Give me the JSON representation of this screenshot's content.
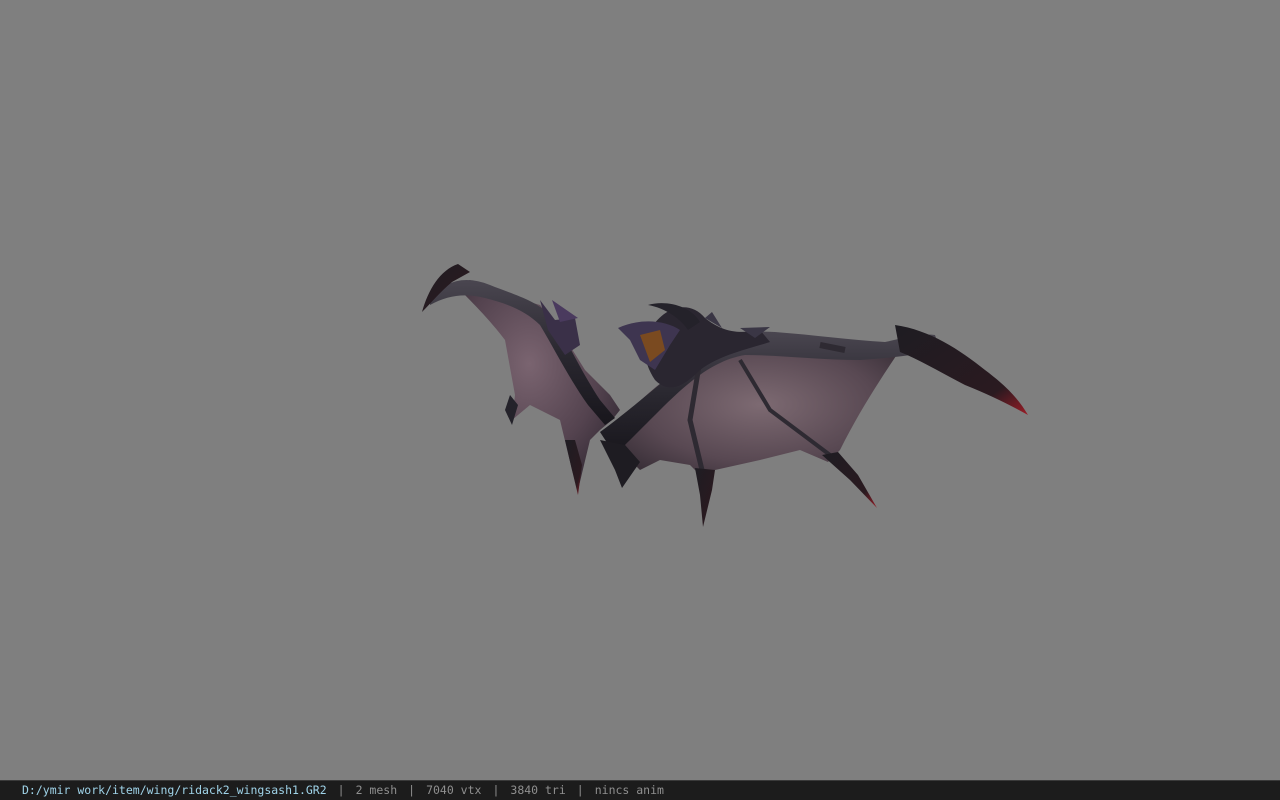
{
  "viewport": {
    "background_color": "#7f7f7f",
    "model_name": "wing-model"
  },
  "status_bar": {
    "file_path": "D:/ymir work/item/wing/ridack2_wingsash1.GR2",
    "separator": "|",
    "mesh_count": "2 mesh",
    "vertex_count": "7040 vtx",
    "triangle_count": "3840 tri",
    "anim_status": "nincs anim"
  },
  "colors": {
    "path_text": "#9fd3e8",
    "status_text": "#8f8f8f",
    "status_bg": "#1c1c1c",
    "membrane": "#5a4a55",
    "bone": "#2a2830",
    "claw_tip": "#8a1a22"
  }
}
